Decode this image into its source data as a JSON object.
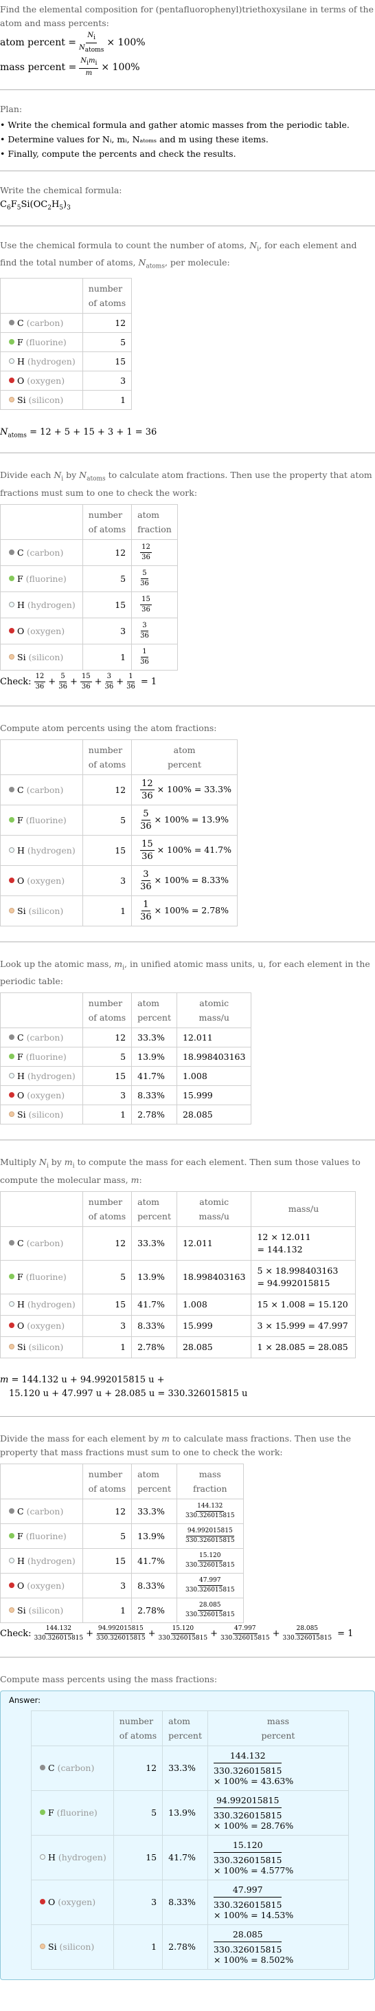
{
  "intro": {
    "question": "Find the elemental composition for (pentafluorophenyl)triethoxysilane in terms of the atom and mass percents:",
    "atom_percent_label": "atom percent =",
    "atom_percent_num": "N",
    "atom_percent_num_sub": "i",
    "atom_percent_den": "N",
    "atom_percent_den_sub": "atoms",
    "times_100": "× 100%",
    "mass_percent_label": "mass percent =",
    "mass_percent_num": "N",
    "mass_percent_num_sub": "i",
    "mass_percent_num2": "m",
    "mass_percent_num2_sub": "i",
    "mass_percent_den": "m"
  },
  "plan": {
    "heading": "Plan:",
    "items": [
      "Write the chemical formula and gather atomic masses from the periodic table.",
      "Determine values for Nᵢ, mᵢ, Nₐₜₒₘₛ and m using these items.",
      "Finally, compute the percents and check the results."
    ]
  },
  "formula": {
    "heading": "Write the chemical formula:",
    "parts": [
      "C",
      "6",
      "F",
      "5",
      "Si(OC",
      "2",
      "H",
      "5",
      ")",
      "3"
    ]
  },
  "headers": {
    "number_of_atoms": [
      "number",
      "of atoms"
    ],
    "atom_fraction": [
      "atom",
      "fraction"
    ],
    "atom_percent": [
      "atom",
      "percent"
    ],
    "atomic_mass": [
      "atomic",
      "mass/u"
    ],
    "mass": "mass/u",
    "mass_fraction": [
      "mass",
      "fraction"
    ],
    "mass_percent": [
      "mass",
      "percent"
    ]
  },
  "elements": [
    {
      "symbol": "C",
      "name": "(carbon)",
      "color": "#8c8c8c",
      "border": "#8c8c8c",
      "count": "12",
      "fraction_num": "12",
      "fraction_den": "36",
      "atom_percent_result": "× 100% = 33.3%",
      "atom_percent": "33.3%",
      "atomic_mass": "12.011",
      "mass_line1": "12 × 12.011",
      "mass_line2": "= 144.132",
      "mass": "144.132",
      "mass_percent_result": "× 100% = 43.63%"
    },
    {
      "symbol": "F",
      "name": "(fluorine)",
      "color": "#85c95a",
      "border": "#85c95a",
      "count": "5",
      "fraction_num": "5",
      "fraction_den": "36",
      "atom_percent_result": "× 100% = 13.9%",
      "atom_percent": "13.9%",
      "atomic_mass": "18.998403163",
      "mass_line1": "5 × 18.998403163",
      "mass_line2": "= 94.992015815",
      "mass": "94.992015815",
      "mass_percent_result": "× 100% = 28.76%"
    },
    {
      "symbol": "H",
      "name": "(hydrogen)",
      "color": "#eefafa",
      "border": "#9a9a9a",
      "count": "15",
      "fraction_num": "15",
      "fraction_den": "36",
      "atom_percent_result": "× 100% = 41.7%",
      "atom_percent": "41.7%",
      "atomic_mass": "1.008",
      "mass_line1": "15 × 1.008 = 15.120",
      "mass_line2": "",
      "mass": "15.120",
      "mass_percent_result": "× 100% = 4.577%"
    },
    {
      "symbol": "O",
      "name": "(oxygen)",
      "color": "#d12f2f",
      "border": "#d12f2f",
      "count": "3",
      "fraction_num": "3",
      "fraction_den": "36",
      "atom_percent_result": "× 100% = 8.33%",
      "atom_percent": "8.33%",
      "atomic_mass": "15.999",
      "mass_line1": "3 × 15.999 = 47.997",
      "mass_line2": "",
      "mass": "47.997",
      "mass_percent_result": "× 100% = 14.53%"
    },
    {
      "symbol": "Si",
      "name": "(silicon)",
      "color": "#f0c8a0",
      "border": "#d0a880",
      "count": "1",
      "fraction_num": "1",
      "fraction_den": "36",
      "atom_percent_result": "× 100% = 2.78%",
      "atom_percent": "2.78%",
      "atomic_mass": "28.085",
      "mass_line1": "1 × 28.085 = 28.085",
      "mass_line2": "",
      "mass": "28.085",
      "mass_percent_result": "× 100% = 8.502%"
    }
  ],
  "step_count": {
    "text_a": "Use the chemical formula to count the number of atoms, ",
    "text_b": ", for each element and find the total number of atoms, ",
    "text_c": ", per molecule:",
    "total_lhs": "N",
    "total_lhs_sub": "atoms",
    "total_rhs": " = 12 + 5 + 15 + 3 + 1 = 36"
  },
  "step_fraction": {
    "text_a": "Divide each ",
    "text_b": " by ",
    "text_c": " to calculate atom fractions. Then use the property that atom fractions must sum to one to check the work:",
    "check_label": "Check:",
    "check_result": "= 1"
  },
  "step_atom_percent": {
    "text": "Compute atom percents using the atom fractions:"
  },
  "step_atomic_mass": {
    "text_a": "Look up the atomic mass, ",
    "text_b": ", in unified atomic mass units, u, for each element in the periodic table:"
  },
  "step_mass": {
    "text_a": "Multiply ",
    "text_b": " by ",
    "text_c": " to compute the mass for each element. Then sum those values to compute the molecular mass, ",
    "text_d": ":",
    "sum_line1": " = 144.132 u + 94.992015815 u +",
    "sum_line2": "15.120 u + 47.997 u + 28.085 u = 330.326015815 u",
    "m_symbol": "m"
  },
  "step_mass_fraction": {
    "text_a": "Divide the mass for each element by ",
    "text_b": " to calculate mass fractions. Then use the property that mass fractions must sum to one to check the work:",
    "denominator": "330.326015815",
    "check_label": "Check:",
    "check_result": "= 1"
  },
  "step_mass_percent": {
    "text": "Compute mass percents using the mass fractions:",
    "answer_label": "Answer:"
  },
  "symbols": {
    "N": "N",
    "i": "i",
    "atoms": "atoms",
    "m": "m",
    "plus": "+"
  }
}
